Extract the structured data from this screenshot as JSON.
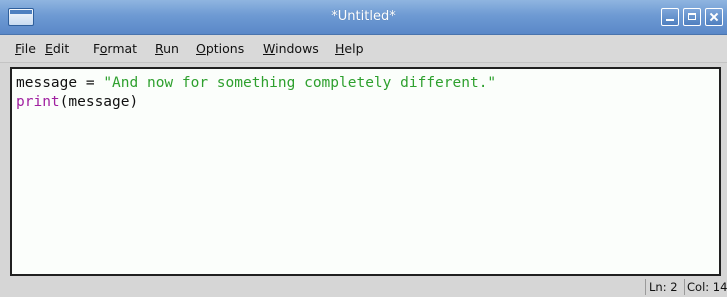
{
  "window": {
    "title": "*Untitled*"
  },
  "menu": {
    "file": {
      "u": "F",
      "rest": "ile"
    },
    "edit": {
      "u": "E",
      "rest": "dit"
    },
    "format": {
      "pre": "F",
      "u": "o",
      "rest": "rmat"
    },
    "run": {
      "u": "R",
      "rest": "un"
    },
    "options": {
      "u": "O",
      "rest": "ptions"
    },
    "windows": {
      "u": "W",
      "rest": "indows"
    },
    "help": {
      "u": "H",
      "rest": "elp"
    }
  },
  "editor": {
    "line1": {
      "var": "message",
      "op": " = ",
      "string": "\"And now for something completely different.\""
    },
    "line2": {
      "builtin": "print",
      "args": "(message)"
    }
  },
  "status": {
    "line": "Ln: 2",
    "col": "Col: 14"
  },
  "colors": {
    "titlebar": "#6e9ad3",
    "editor_bg": "#fbfefb",
    "string": "#2ea02e",
    "builtin": "#a020a0"
  }
}
